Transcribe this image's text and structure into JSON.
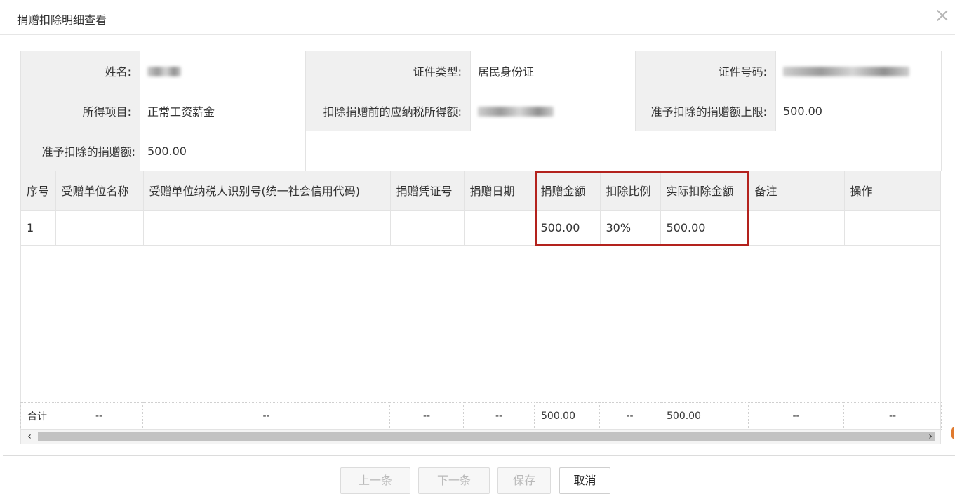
{
  "window": {
    "title": "捐赠扣除明细查看"
  },
  "info": {
    "name_label": "姓名:",
    "id_type_label": "证件类型:",
    "id_type_value": "居民身份证",
    "id_number_label": "证件号码:",
    "income_item_label": "所得项目:",
    "income_item_value": "正常工资薪金",
    "taxable_before_label": "扣除捐赠前的应纳税所得额:",
    "deduction_limit_label": "准予扣除的捐赠额上限:",
    "deduction_limit_value": "500.00",
    "allowed_deduction_label": "准予扣除的捐赠额:",
    "allowed_deduction_value": "500.00"
  },
  "grid": {
    "columns": [
      "序号",
      "受赠单位名称",
      "受赠单位纳税人识别号(统一社会信用代码)",
      "捐赠凭证号",
      "捐赠日期",
      "捐赠金额",
      "扣除比例",
      "实际扣除金额",
      "备注",
      "操作"
    ],
    "rows": [
      [
        "1",
        "",
        "",
        "",
        "",
        "500.00",
        "30%",
        "500.00",
        "",
        ""
      ]
    ],
    "total": [
      "合计",
      "--",
      "--",
      "--",
      "--",
      "500.00",
      "--",
      "500.00",
      "--",
      "--"
    ]
  },
  "footer": {
    "prev_label": "上一条",
    "next_label": "下一条",
    "save_label": "保存",
    "cancel_label": "取消"
  },
  "colors": {
    "highlight": "#b3221d",
    "header_bg": "#f0f0f0"
  }
}
